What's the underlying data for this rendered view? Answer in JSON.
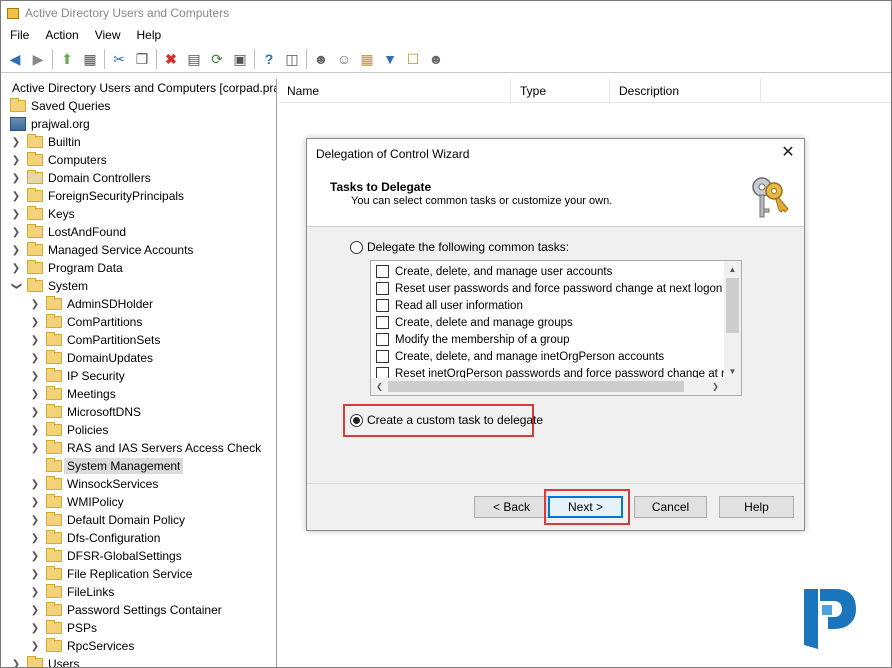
{
  "window": {
    "title": "Active Directory Users and Computers"
  },
  "menu": [
    "File",
    "Action",
    "View",
    "Help"
  ],
  "tree": {
    "root": "Active Directory Users and Computers [corpad.pra",
    "saved_queries": "Saved Queries",
    "domain": "prajwal.org",
    "domain_children": [
      "Builtin",
      "Computers",
      "Domain Controllers",
      "ForeignSecurityPrincipals",
      "Keys",
      "LostAndFound",
      "Managed Service Accounts",
      "Program Data",
      "System"
    ],
    "system_children": [
      "AdminSDHolder",
      "ComPartitions",
      "ComPartitionSets",
      "DomainUpdates",
      "IP Security",
      "Meetings",
      "MicrosoftDNS",
      "Policies",
      "RAS and IAS Servers Access Check",
      "System Management",
      "WinsockServices",
      "WMIPolicy",
      "Default Domain Policy",
      "Dfs-Configuration",
      "DFSR-GlobalSettings",
      "File Replication Service",
      "FileLinks",
      "Password Settings Container",
      "PSPs",
      "RpcServices"
    ],
    "after_system": "Users",
    "selected": "System Management"
  },
  "list": {
    "columns": [
      "Name",
      "Type",
      "Description"
    ]
  },
  "dialog": {
    "title": "Delegation of Control Wizard",
    "heading": "Tasks to Delegate",
    "subheading": "You can select common tasks or customize your own.",
    "option_common": "Delegate the following common tasks:",
    "option_custom": "Create a custom task to delegate",
    "selected_option": "custom",
    "tasks": [
      "Create, delete, and manage user accounts",
      "Reset user passwords and force password change at next logon",
      "Read all user information",
      "Create, delete and manage groups",
      "Modify the membership of a group",
      "Create, delete, and manage inetOrgPerson accounts",
      "Reset inetOrgPerson passwords and force password change at next lo"
    ],
    "buttons": {
      "back": "< Back",
      "next": "Next >",
      "cancel": "Cancel",
      "help": "Help"
    }
  },
  "colors": {
    "highlight": "#d93a3a",
    "default_button_border": "#0078d7",
    "logo_blue": "#1b75bc"
  }
}
